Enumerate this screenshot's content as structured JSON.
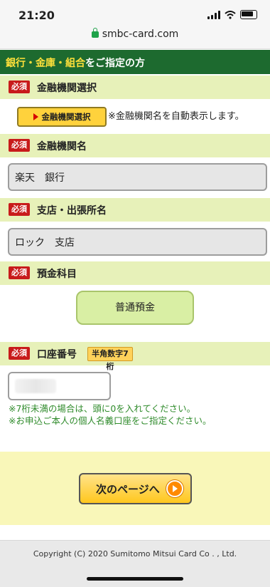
{
  "status": {
    "time": "21:20"
  },
  "browser": {
    "url": "smbc-card.com"
  },
  "header": {
    "title_highlight": "銀行・金庫・組合",
    "title_rest": "をご指定の方"
  },
  "sections": {
    "bank_select": {
      "required": "必須",
      "label": "金融機関選択",
      "button": "金融機関選択",
      "note": "※金融機関名を自動表示します。"
    },
    "bank_name": {
      "required": "必須",
      "label": "金融機関名",
      "value": "楽天　銀行"
    },
    "branch": {
      "required": "必須",
      "label": "支店・出張所名",
      "value": "ロック　支店"
    },
    "deposit_type": {
      "required": "必須",
      "label": "預金科目",
      "value": "普通預金"
    },
    "account": {
      "required": "必須",
      "label": "口座番号",
      "badge": "半角数字7桁"
    }
  },
  "notes": [
    "※7桁未満の場合は、頭に0を入れてください。",
    "※お申込ご本人の個人名義口座をご指定ください。"
  ],
  "next_button": {
    "label": "次のページへ"
  },
  "footer": {
    "copyright": "Copyright (C) 2020 Sumitomo Mitsui Card Co . , Ltd."
  }
}
